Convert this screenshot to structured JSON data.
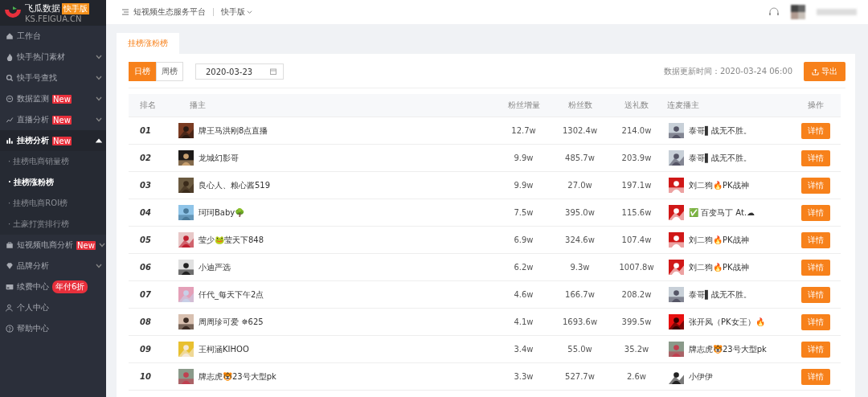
{
  "logo": {
    "name": "飞瓜数据",
    "badge": "快手版",
    "domain": "KS.FEIGUA.CN"
  },
  "sidebar": {
    "items": [
      {
        "label": "工作台",
        "selected": false
      },
      {
        "label": "快手热门素材",
        "selected": false,
        "expanded": false
      },
      {
        "label": "快手号查找",
        "selected": false,
        "expanded": false
      },
      {
        "label": "数据监测",
        "badge": "New",
        "selected": false,
        "expanded": false
      },
      {
        "label": "直播分析",
        "badge": "New",
        "selected": false,
        "expanded": false
      },
      {
        "label": "挂榜分析",
        "badge": "New",
        "selected": true,
        "expanded": true,
        "children": [
          {
            "label": "· 挂榜电商销量榜",
            "selected": false
          },
          {
            "label": "· 挂榜涨粉榜",
            "selected": true
          },
          {
            "label": "· 挂榜电商ROI榜",
            "selected": false
          },
          {
            "label": "· 土豪打赏排行榜",
            "selected": false
          }
        ]
      },
      {
        "label": "短视频电商分析",
        "badge": "New",
        "selected": false,
        "expanded": false
      },
      {
        "label": "品牌分析",
        "selected": false,
        "expanded": false
      },
      {
        "label": "续费中心",
        "badge": "年付6折",
        "selected": false
      },
      {
        "label": "个人中心",
        "selected": false
      },
      {
        "label": "帮助中心",
        "selected": false
      }
    ]
  },
  "topbar": {
    "platform": "短视频生态服务平台",
    "version": "快手版"
  },
  "tabs": [
    {
      "label": "挂榜涨粉榜",
      "selected": true
    }
  ],
  "period_toggle": [
    {
      "label": "日榜",
      "selected": true
    },
    {
      "label": "周榜",
      "selected": false
    }
  ],
  "date_field": {
    "value": "2020-03-23"
  },
  "update_time": "数据更新时间：2020-03-24 06:00",
  "export_button": "导出",
  "table": {
    "columns": [
      "排名",
      "播主",
      "粉丝增量",
      "粉丝数",
      "送礼数",
      "连麦播主",
      "操作"
    ],
    "rows": [
      {
        "rank": "01",
        "streamer": "牌王马洪刚8点直播",
        "fan_growth": "12.7w",
        "fans": "1302.4w",
        "gifts": "214.0w",
        "co_host": "泰哥▌战无不胜。",
        "action": "详情"
      },
      {
        "rank": "02",
        "streamer": "龙城幻影哥",
        "fan_growth": "9.9w",
        "fans": "485.7w",
        "gifts": "203.9w",
        "co_host": "泰哥▌战无不胜。",
        "action": "详情"
      },
      {
        "rank": "03",
        "streamer": "良心人、粮心酱519",
        "fan_growth": "9.9w",
        "fans": "27.0w",
        "gifts": "197.1w",
        "co_host": "刘二狗🔥PK战神",
        "action": "详情"
      },
      {
        "rank": "04",
        "streamer": "珂珂Baby🌳",
        "fan_growth": "7.5w",
        "fans": "395.0w",
        "gifts": "115.6w",
        "co_host": "✅ 百变马丁 At.☁",
        "action": "详情"
      },
      {
        "rank": "05",
        "streamer": "莹少🐸莹天下848",
        "fan_growth": "6.9w",
        "fans": "324.6w",
        "gifts": "107.4w",
        "co_host": "刘二狗🔥PK战神",
        "action": "详情"
      },
      {
        "rank": "06",
        "streamer": "小迪严选",
        "fan_growth": "6.2w",
        "fans": "9.3w",
        "gifts": "1007.8w",
        "co_host": "刘二狗🔥PK战神",
        "action": "详情"
      },
      {
        "rank": "07",
        "streamer": "仟代_每天下午2点",
        "fan_growth": "4.6w",
        "fans": "166.7w",
        "gifts": "208.2w",
        "co_host": "泰哥▌战无不胜。",
        "action": "详情"
      },
      {
        "rank": "08",
        "streamer": "周周珍可爱 ✵625",
        "fan_growth": "4.1w",
        "fans": "1693.6w",
        "gifts": "399.5w",
        "co_host": "张开凤（PK女王）🔥",
        "action": "详情"
      },
      {
        "rank": "09",
        "streamer": "王柯涵KIHOO",
        "fan_growth": "3.4w",
        "fans": "55.0w",
        "gifts": "35.2w",
        "co_host": "牌志虎🐯23号大型pk",
        "action": "详情"
      },
      {
        "rank": "10",
        "streamer": "牌志虎🐯23号大型pk",
        "fan_growth": "3.3w",
        "fans": "527.7w",
        "gifts": "2.6w",
        "co_host": "小伊伊",
        "action": "详情"
      }
    ]
  }
}
